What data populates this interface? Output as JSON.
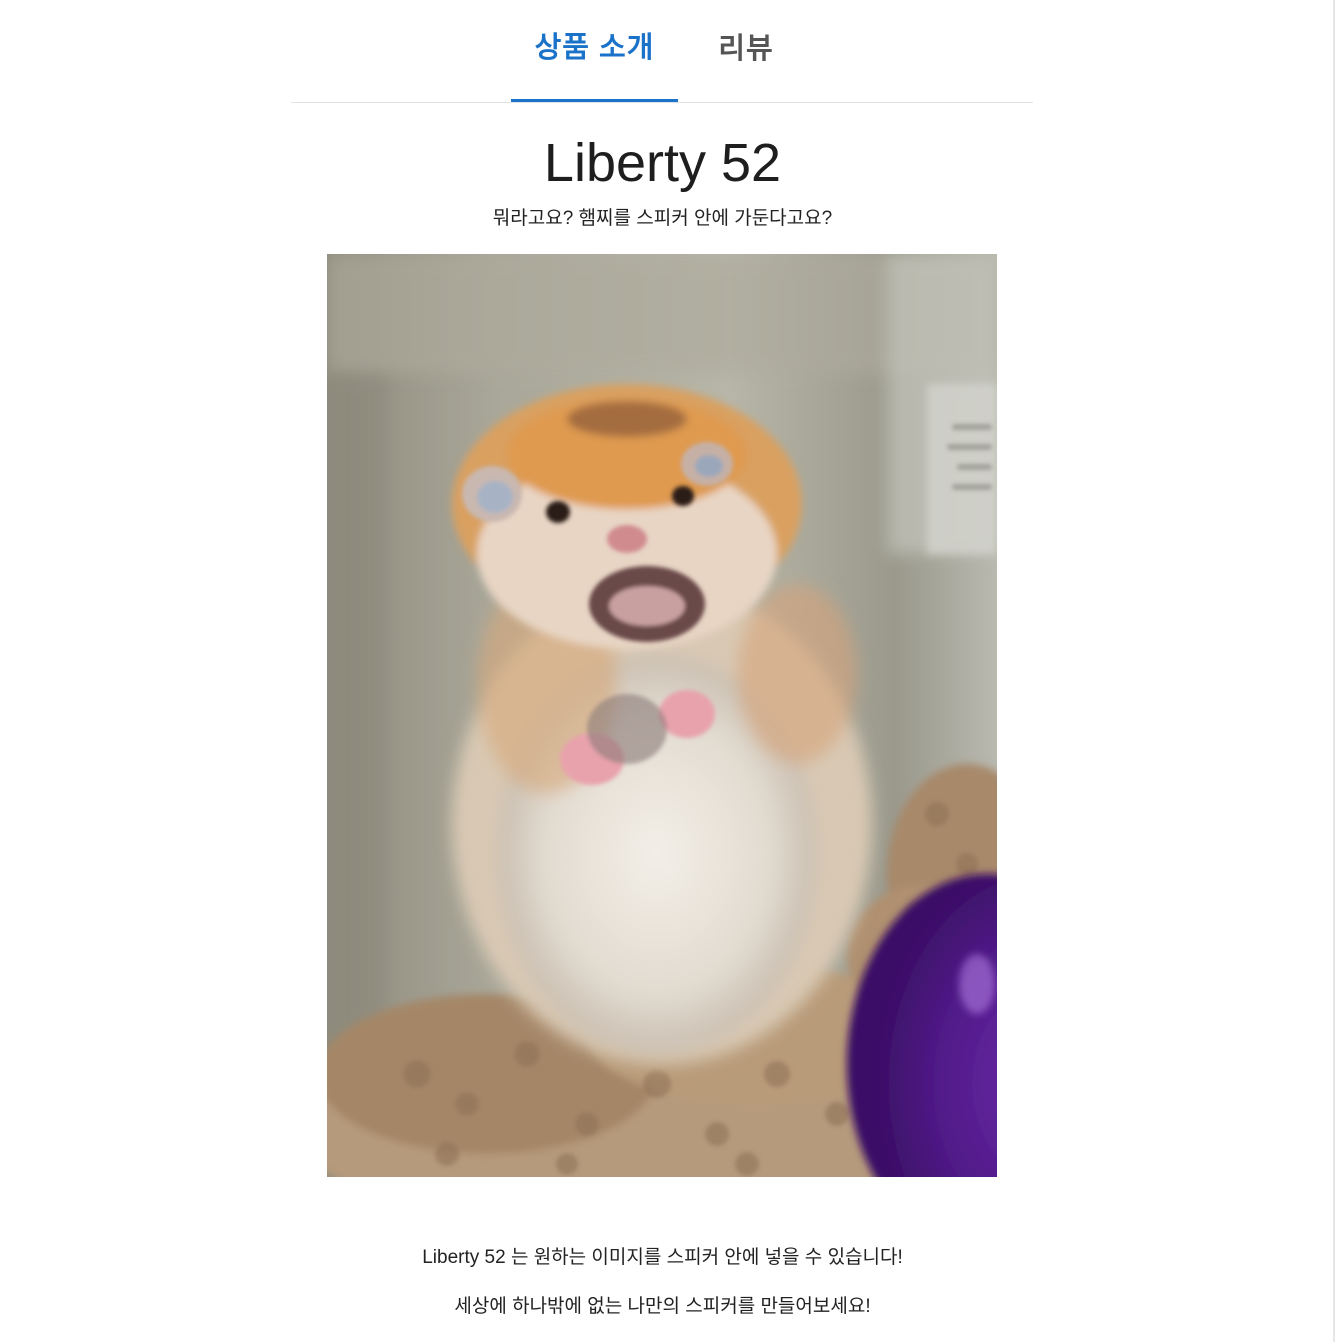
{
  "tabs": {
    "intro_label": "상품 소개",
    "review_label": "리뷰",
    "active": "intro"
  },
  "product": {
    "name": "Liberty 52",
    "tagline": "뭐라고요? 햄찌를 스피커 안에 가둔다고요?",
    "image_subject": "hamster-photo",
    "description_1": "Liberty 52 는 원하는 이미지를 스피커 안에 넣을 수 있습니다!",
    "description_2": "세상에 하나밖에 없는 나만의 스피커를 만들어보세요!"
  },
  "colors": {
    "accent": "#1a73c8",
    "inactive_tab": "#555555",
    "text": "#222222",
    "divider": "#e2e2e2"
  }
}
